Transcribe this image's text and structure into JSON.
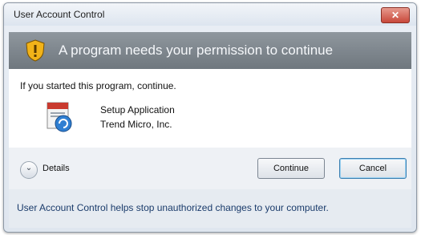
{
  "window": {
    "title": "User Account Control",
    "close_label": "✕"
  },
  "banner": {
    "text": "A program needs your permission to continue"
  },
  "content": {
    "intro": "If you started this program, continue.",
    "app_name": "Setup Application",
    "publisher": "Trend Micro, Inc."
  },
  "footer": {
    "details_label": "Details",
    "continue_label": "Continue",
    "cancel_label": "Cancel"
  },
  "status": {
    "text": "User Account Control helps stop unauthorized changes to your computer."
  },
  "colors": {
    "banner": "#7f878e",
    "close_button": "#c8483a",
    "status_text": "#1a3b6b"
  },
  "icons": [
    "shield-icon",
    "setup-application-icon",
    "chevron-down-icon",
    "close-icon"
  ]
}
